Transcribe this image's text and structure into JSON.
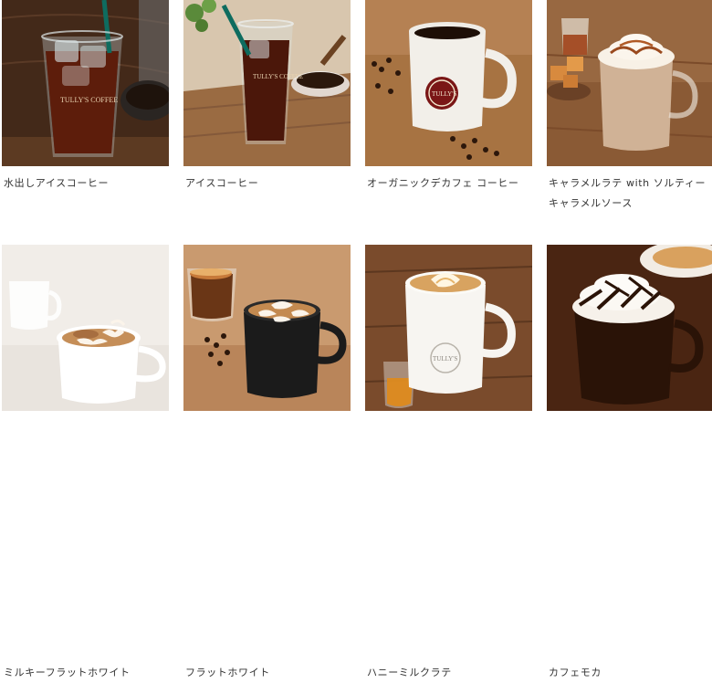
{
  "menu": {
    "items": [
      {
        "name": "水出しアイスコーヒー",
        "image": "cold-brew-iced-coffee-image"
      },
      {
        "name": "アイスコーヒー",
        "image": "iced-coffee-image"
      },
      {
        "name": "オーガニックデカフェ コーヒー",
        "image": "organic-decaf-coffee-mug-image"
      },
      {
        "name": "キャラメルラテ with ソルティーキャラメルソース",
        "image": "caramel-latte-image"
      },
      {
        "name": "ミルキーフラットホワイト",
        "image": "milky-flat-white-image"
      },
      {
        "name": "フラットホワイト",
        "image": "flat-white-image"
      },
      {
        "name": "ハニーミルクラテ",
        "image": "honey-milk-latte-image"
      },
      {
        "name": "カフェモカ",
        "image": "cafe-mocha-image"
      }
    ],
    "mug_logo_text": "TULLY'S COFFEE"
  }
}
